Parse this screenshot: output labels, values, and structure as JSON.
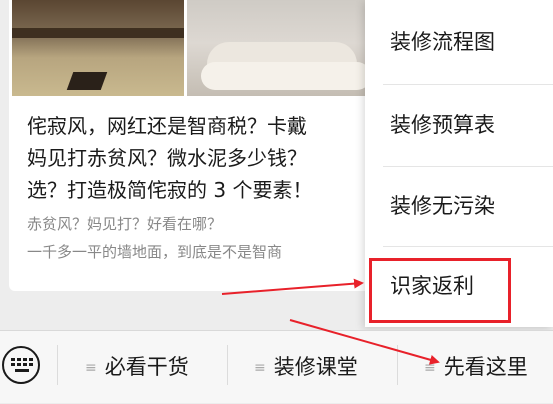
{
  "article": {
    "title_lines": [
      "侘寂风，网红还是智商税？卡戴",
      "妈见打赤贫风？微水泥多少钱？",
      "选？打造极简侘寂的 3 个要素！"
    ],
    "desc_lines": [
      "赤贫风？妈见打？好看在哪？",
      "一千多一平的墙地面，到底是不是智商"
    ]
  },
  "popup_menu": {
    "items": [
      "装修流程图",
      "装修预算表",
      "装修无污染",
      "识家返利"
    ],
    "highlighted_index": 3
  },
  "bottom_menu": {
    "tabs": [
      "必看干货",
      "装修课堂",
      "先看这里"
    ],
    "menu_icon": "≡"
  },
  "annotation": {
    "color": "#e8212a"
  }
}
